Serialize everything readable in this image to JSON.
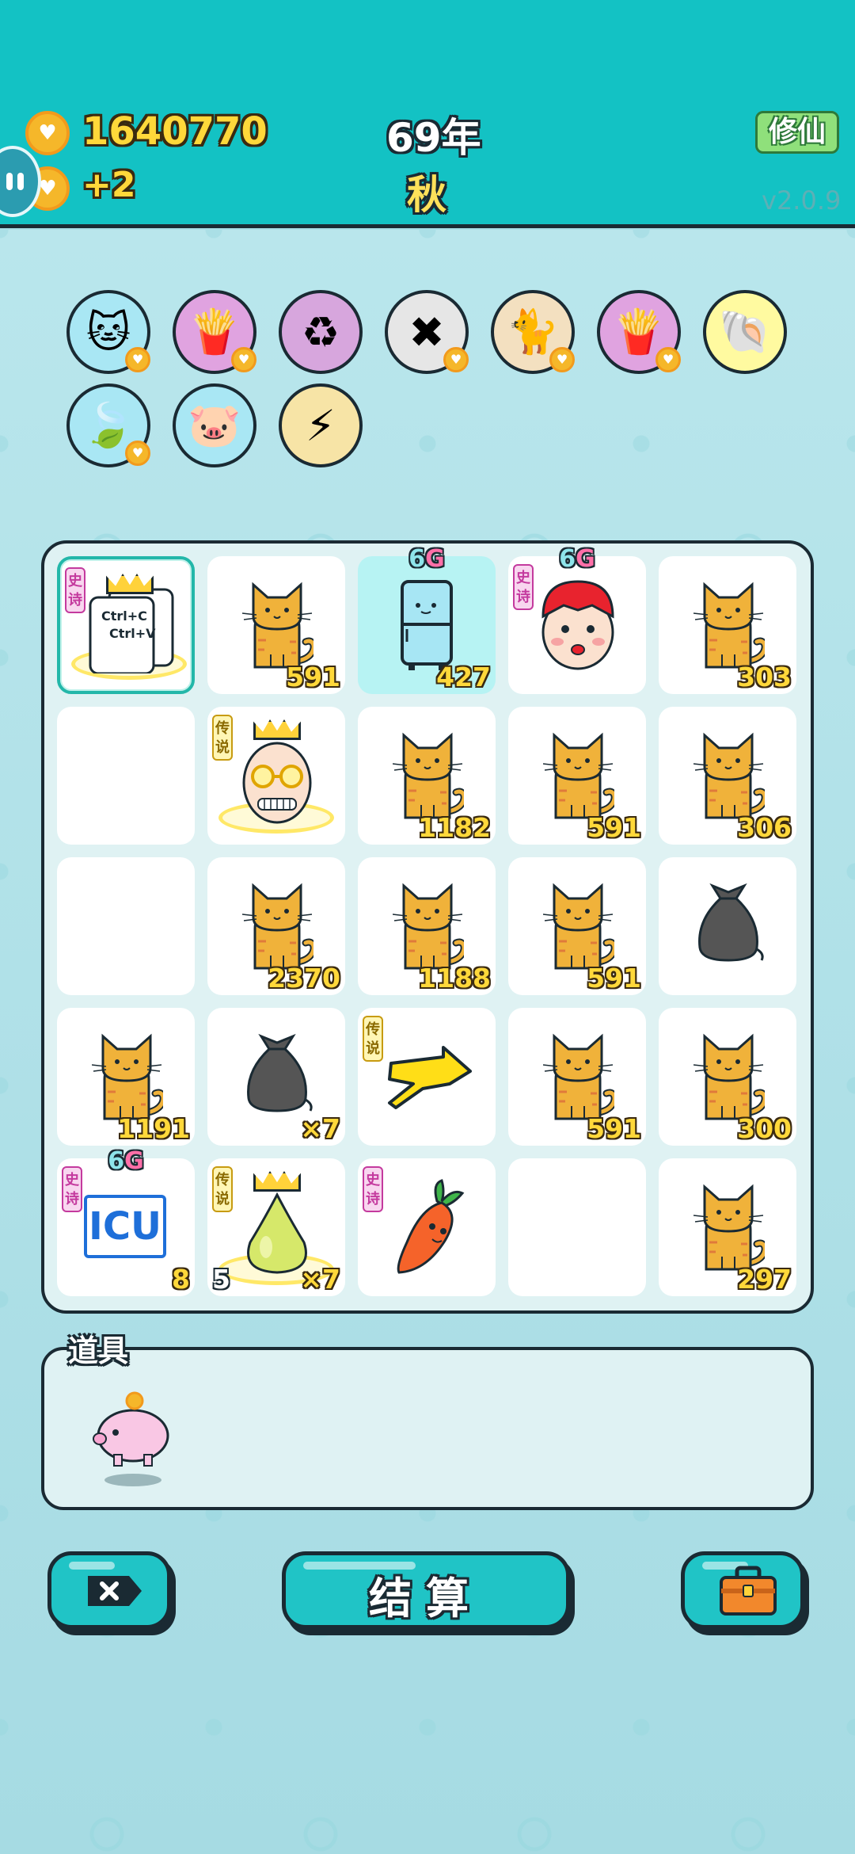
{
  "header": {
    "coins": "1640770",
    "income": "+2",
    "year": "69年",
    "season": "秋",
    "mode_button": "修仙",
    "version": "v2.0.9"
  },
  "buffs": [
    {
      "icon": "cat-hole-icon",
      "bg": "#a9e7f4",
      "badge": true
    },
    {
      "icon": "fries-icon",
      "bg": "#e0a3e0",
      "badge": true
    },
    {
      "icon": "recycle-icon",
      "bg": "#d7a6dd",
      "badge": false
    },
    {
      "icon": "delete-tag-icon",
      "bg": "#e6e6e6",
      "badge": true
    },
    {
      "icon": "twin-cats-icon",
      "bg": "#f3e0c0",
      "badge": true
    },
    {
      "icon": "fries-icon",
      "bg": "#e0a3e0",
      "badge": true
    },
    {
      "icon": "shell-icon",
      "bg": "#fffaa0",
      "badge": false
    },
    {
      "icon": "leaf-icon",
      "bg": "#a9e7f4",
      "badge": true
    },
    {
      "icon": "piggy-bank-icon",
      "bg": "#a9e7f4",
      "badge": false
    },
    {
      "icon": "lightning-icon",
      "bg": "#f7e4a6",
      "badge": false
    }
  ],
  "tags": {
    "epic": "史诗",
    "legend": "传说",
    "sixg_6": "6",
    "sixg_g": "G"
  },
  "board": [
    [
      {
        "item": "copy-paste-icon",
        "tag": "epic",
        "crown": true,
        "halo": true,
        "selected": true,
        "copy_text_1": "Ctrl+C",
        "copy_text_2": "Ctrl+V"
      },
      {
        "item": "cat",
        "value": "591"
      },
      {
        "item": "fridge",
        "sixg": true,
        "value": "427"
      },
      {
        "item": "girl",
        "tag": "epic",
        "sixg": true
      },
      {
        "item": "cat",
        "value": "303"
      }
    ],
    [
      {
        "item": "empty"
      },
      {
        "item": "grandpa",
        "tag": "legend",
        "crown": true,
        "halo": true
      },
      {
        "item": "cat",
        "value": "1182"
      },
      {
        "item": "cat",
        "value": "591"
      },
      {
        "item": "cat",
        "value": "306"
      }
    ],
    [
      {
        "item": "empty"
      },
      {
        "item": "cat",
        "value": "2370"
      },
      {
        "item": "cat",
        "value": "1188"
      },
      {
        "item": "cat",
        "value": "591"
      },
      {
        "item": "trash"
      }
    ],
    [
      {
        "item": "cat",
        "value": "1191"
      },
      {
        "item": "trash",
        "value": "×7"
      },
      {
        "item": "pointer",
        "tag": "legend"
      },
      {
        "item": "cat",
        "value": "591"
      },
      {
        "item": "cat",
        "value": "300"
      }
    ],
    [
      {
        "item": "icu",
        "tag": "epic",
        "sixg": true,
        "value": "8",
        "icu_text": "ICU"
      },
      {
        "item": "pear",
        "tag": "legend",
        "crown": true,
        "halo": true,
        "left_value": "5",
        "value": "×7"
      },
      {
        "item": "carrot",
        "tag": "epic"
      },
      {
        "item": "empty"
      },
      {
        "item": "cat",
        "value": "297"
      }
    ]
  ],
  "tools": {
    "label": "道具",
    "items": [
      "piggy-bank-icon"
    ]
  },
  "buttons": {
    "settle": "结算",
    "remove": "remove-tag-icon",
    "bag": "briefcase-icon"
  }
}
